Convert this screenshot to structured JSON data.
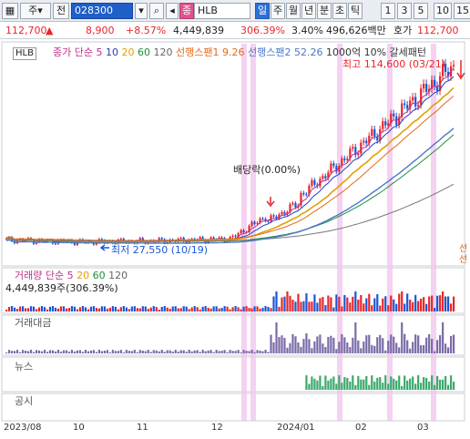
{
  "toolbar": {
    "menu_icon": "grid-icon",
    "market": "주",
    "market_dd": "▾",
    "prev": "전",
    "code": "028300",
    "lookup": "▾",
    "search_icon": "search-icon",
    "sound_icon": "speaker-icon",
    "stock_tag": "종",
    "stock_name": "HLB",
    "periods": [
      "일",
      "주",
      "월",
      "년",
      "분",
      "초",
      "틱"
    ],
    "minutes": [
      "1",
      "3",
      "5",
      "10",
      "15"
    ]
  },
  "quote": {
    "price": "112,700",
    "arrow": "▲",
    "change": "8,900",
    "change_pct": "+8.57%",
    "volume": "4,449,839",
    "volume_ratio": "306.39%",
    "turnover_rate": "3.40%",
    "amount": "496,626백만",
    "ask_label": "호가",
    "ask_price": "112,700"
  },
  "chart": {
    "symbol_tag": "HLB",
    "legend": [
      {
        "text": "종가 단순",
        "color": "#c0308a"
      },
      {
        "text": "5",
        "color": "#c0308a"
      },
      {
        "text": "10",
        "color": "#2040c0"
      },
      {
        "text": "20",
        "color": "#e0a000"
      },
      {
        "text": "60",
        "color": "#1f8f3a"
      },
      {
        "text": "120",
        "color": "#666666"
      },
      {
        "text": "선행스팬1",
        "color": "#e06a1a"
      },
      {
        "text": "9.26",
        "color": "#e06a1a"
      },
      {
        "text": "선행스팬2",
        "color": "#4a78c8"
      },
      {
        "text": "52.26",
        "color": "#4a78c8"
      },
      {
        "text": "1000억",
        "color": "#333333"
      },
      {
        "text": "10%",
        "color": "#333333"
      },
      {
        "text": "갈세패턴",
        "color": "#333333"
      }
    ],
    "high_annot": "최고 114,600 (03/21)",
    "low_annot": "최저 27,550 (10/19)",
    "dividend_annot": "배당락(0.00%)",
    "edge_label_1": "선",
    "edge_label_2": "선"
  },
  "volume_panel": {
    "legend_title": "거래량 단순",
    "legend_periods": [
      "5",
      "20",
      "60",
      "120"
    ],
    "value": "4,449,839주(306.39%)"
  },
  "panels": {
    "amount_label": "거래대금",
    "news_label": "뉴스",
    "disclosure_label": "공시"
  },
  "x_axis": [
    "2023/08",
    "10",
    "11",
    "12",
    "2024/01",
    "02",
    "03"
  ],
  "chart_data": {
    "type": "line",
    "title": "",
    "x": [
      "2023/08",
      "10",
      "11",
      "12",
      "2024/01",
      "02",
      "03"
    ],
    "series": [
      {
        "values": [
          29000,
          28000,
          28500,
          29500,
          52000,
          82000,
          112700
        ]
      }
    ],
    "high": {
      "value": 114600,
      "date": "03/21"
    },
    "low": {
      "value": 27550,
      "date": "10/19"
    }
  }
}
